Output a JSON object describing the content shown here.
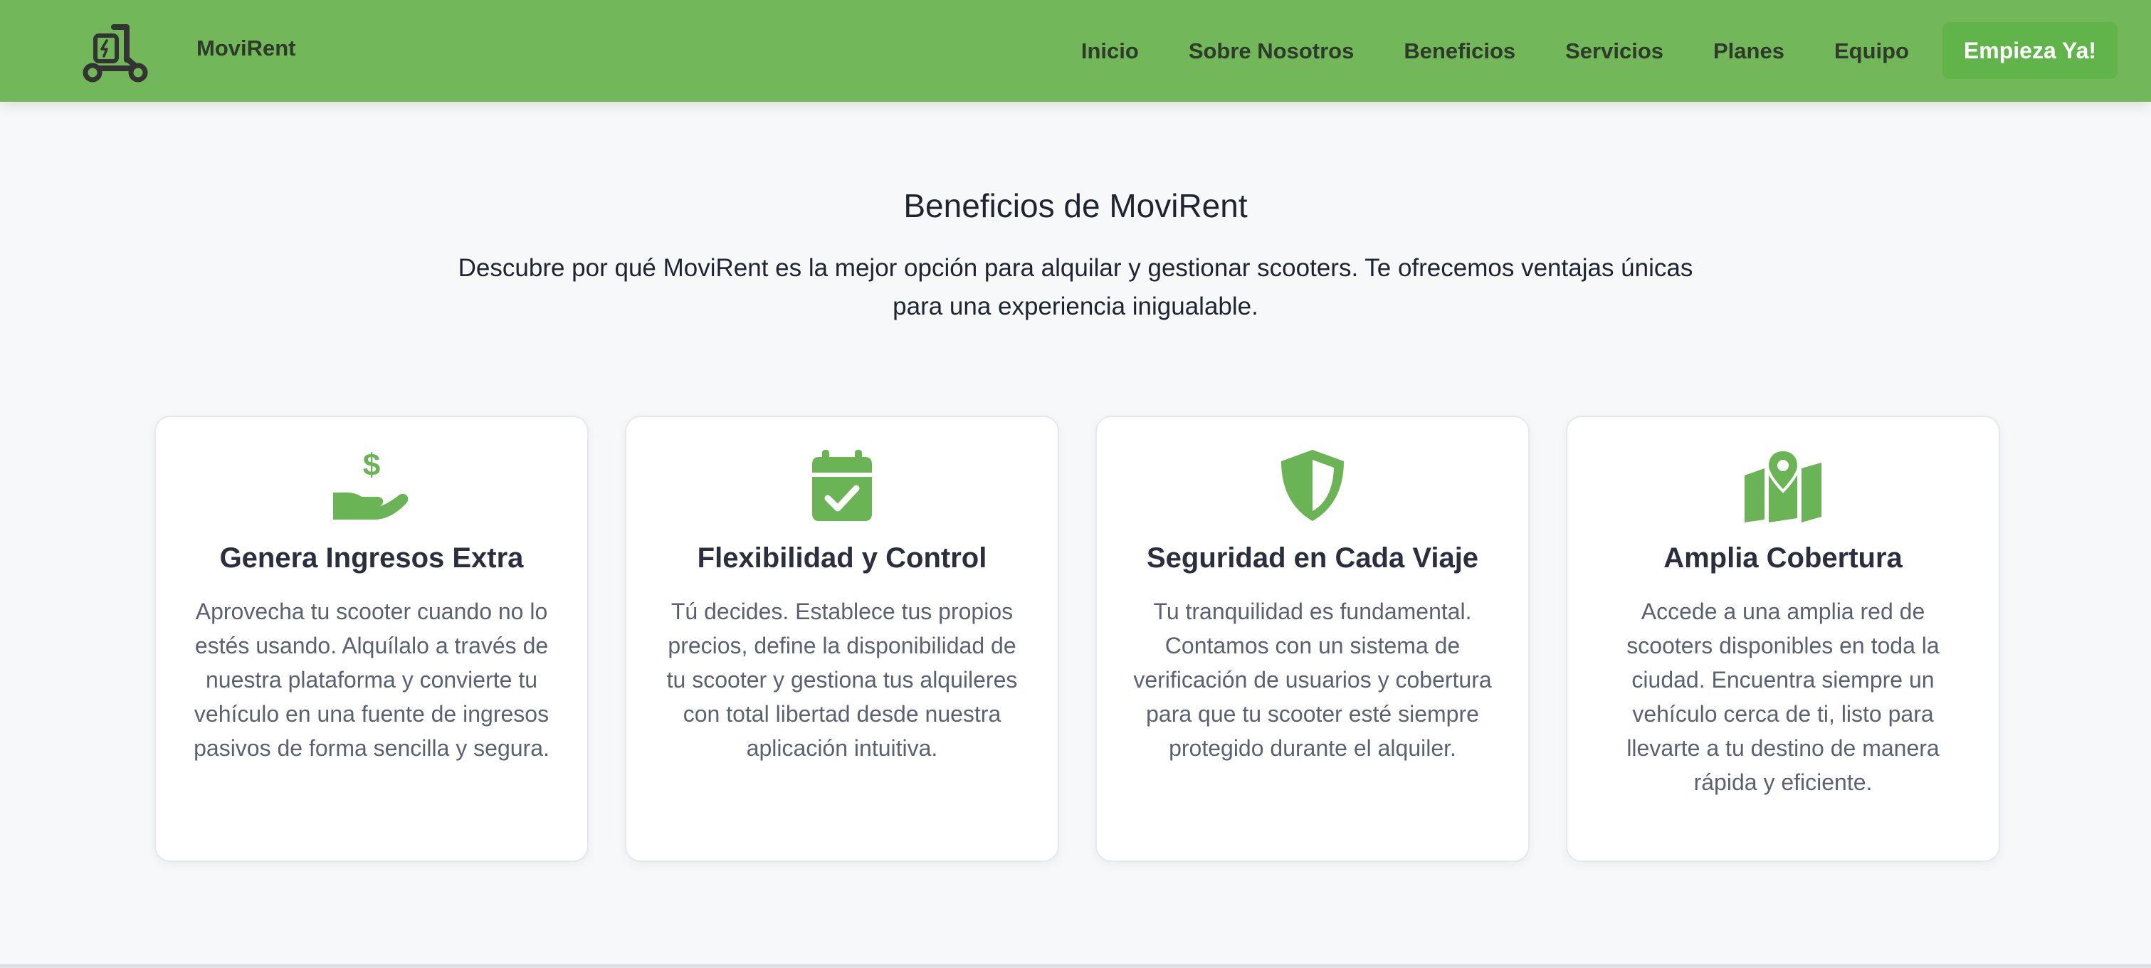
{
  "colors": {
    "brand_green": "#72b85a",
    "button_green": "#60b449",
    "icon_green": "#6ab455",
    "page_background": "#f7f8fa"
  },
  "header": {
    "logo_icon": "scooter-icon",
    "brand_name": "MoviRent",
    "nav_items": [
      {
        "label": "Inicio"
      },
      {
        "label": "Sobre Nosotros"
      },
      {
        "label": "Beneficios"
      },
      {
        "label": "Servicios"
      },
      {
        "label": "Planes"
      },
      {
        "label": "Equipo"
      }
    ],
    "cta_label": "Empieza Ya!"
  },
  "benefits": {
    "title": "Beneficios de MoviRent",
    "subtitle": "Descubre por qué MoviRent es la mejor opción para alquilar y gestionar scooters. Te ofrecemos ventajas únicas para una experiencia inigualable.",
    "cards": [
      {
        "icon": "hand-dollar-icon",
        "title": "Genera Ingresos Extra",
        "text": "Aprovecha tu scooter cuando no lo estés usando. Alquílalo a través de nuestra plataforma y convierte tu vehículo en una fuente de ingresos pasivos de forma sencilla y segura."
      },
      {
        "icon": "calendar-check-icon",
        "title": "Flexibilidad y Control",
        "text": "Tú decides. Establece tus propios precios, define la disponibilidad de tu scooter y gestiona tus alquileres con total libertad desde nuestra aplicación intuitiva."
      },
      {
        "icon": "shield-icon",
        "title": "Seguridad en Cada Viaje",
        "text": "Tu tranquilidad es fundamental. Contamos con un sistema de verificación de usuarios y cobertura para que tu scooter esté siempre protegido durante el alquiler."
      },
      {
        "icon": "map-pin-icon",
        "title": "Amplia Cobertura",
        "text": "Accede a una amplia red de scooters disponibles en toda la ciudad. Encuentra siempre un vehículo cerca de ti, listo para llevarte a tu destino de manera rápida y eficiente."
      }
    ]
  }
}
